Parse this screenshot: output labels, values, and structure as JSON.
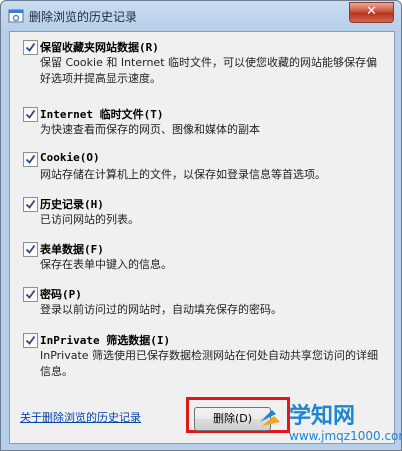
{
  "window": {
    "title": "删除浏览的历史记录",
    "close_glyph": "✕"
  },
  "options": [
    {
      "title": "保留收藏夹网站数据(R)",
      "desc": "保留 Cookie 和 Internet 临时文件，可以使您收藏的网站能够保存偏好选项并提高显示速度。"
    },
    {
      "title": "Internet 临时文件(T)",
      "desc": "为快速查看而保存的网页、图像和媒体的副本"
    },
    {
      "title": "Cookie(O)",
      "desc": "网站存储在计算机上的文件，以保存如登录信息等首选项。"
    },
    {
      "title": "历史记录(H)",
      "desc": "已访问网站的列表。"
    },
    {
      "title": "表单数据(F)",
      "desc": "保存在表单中键入的信息。"
    },
    {
      "title": "密码(P)",
      "desc": "登录以前访问过的网站时，自动填充保存的密码。"
    },
    {
      "title": "InPrivate 筛选数据(I)",
      "desc": "InPrivate 筛选使用已保存数据检测网站在何处自动共享您访问的详细信息。"
    }
  ],
  "footer": {
    "link_label": "关于删除浏览的历史记录",
    "delete_label": "删除(D)"
  },
  "watermark": {
    "main": "学知网",
    "sub": "www.jmqz1000.com"
  },
  "colors": {
    "highlight_border": "#e01818",
    "link": "#0645ad",
    "logo": "#1d86d0"
  }
}
